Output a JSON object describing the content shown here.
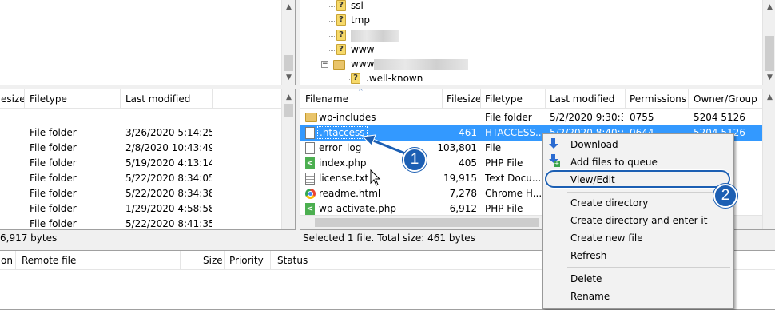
{
  "remote_tree": {
    "items": [
      {
        "label": "ssl"
      },
      {
        "label": "tmp"
      },
      {
        "label": ""
      },
      {
        "label": "www"
      },
      {
        "label": "www"
      },
      {
        "label": ".well-known"
      }
    ]
  },
  "local_list": {
    "headers": {
      "filesize": "esize",
      "filetype": "Filetype",
      "last_modified": "Last modified"
    },
    "rows": [
      {
        "filetype": "File folder",
        "modified": "3/26/2020 5:14:25 ..."
      },
      {
        "filetype": "File folder",
        "modified": "2/8/2020 10:43:49 ..."
      },
      {
        "filetype": "File folder",
        "modified": "5/19/2020 4:13:14 ..."
      },
      {
        "filetype": "File folder",
        "modified": "5/22/2020 8:34:05 ..."
      },
      {
        "filetype": "File folder",
        "modified": "5/22/2020 8:34:38 ..."
      },
      {
        "filetype": "File folder",
        "modified": "1/29/2020 4:58:58 ..."
      },
      {
        "filetype": "File folder",
        "modified": "5/22/2020 8:41:35 ..."
      }
    ],
    "status": "6,917 bytes"
  },
  "remote_list": {
    "headers": {
      "filename": "Filename",
      "filesize": "Filesize",
      "filetype": "Filetype",
      "last_modified": "Last modified",
      "permissions": "Permissions",
      "owner": "Owner/Group"
    },
    "rows": [
      {
        "name": "wp-includes",
        "size": "",
        "type": "File folder",
        "modified": "5/2/2020 9:30:3...",
        "perms": "0755",
        "owner": "5204 5126"
      },
      {
        "name": ".htaccess",
        "size": "461",
        "type": "HTACCESS...",
        "modified": "5/2/2020 8:40:4...",
        "perms": "0644",
        "owner": "5204 5126"
      },
      {
        "name": "error_log",
        "size": "103,801",
        "type": "File",
        "modified": "",
        "perms": "",
        "owner": ""
      },
      {
        "name": "index.php",
        "size": "405",
        "type": "PHP File",
        "modified": "",
        "perms": "",
        "owner": ""
      },
      {
        "name": "license.txt",
        "size": "19,915",
        "type": "Text Docu...",
        "modified": "",
        "perms": "",
        "owner": ""
      },
      {
        "name": "readme.html",
        "size": "7,278",
        "type": "Chrome H...",
        "modified": "",
        "perms": "",
        "owner": ""
      },
      {
        "name": "wp-activate.php",
        "size": "6,912",
        "type": "PHP File",
        "modified": "",
        "perms": "",
        "owner": ""
      }
    ],
    "status": "Selected 1 file. Total size: 461 bytes"
  },
  "queue": {
    "headers": {
      "direction": "on",
      "remote_file": "Remote file",
      "size": "Size",
      "priority": "Priority",
      "status": "Status"
    }
  },
  "context_menu": {
    "items": [
      "Download",
      "Add files to queue",
      "View/Edit",
      "Create directory",
      "Create directory and enter it",
      "Create new file",
      "Refresh",
      "Delete",
      "Rename"
    ]
  },
  "annotations": {
    "badge1": "1",
    "badge2": "2"
  },
  "colors": {
    "selection": "#3399ff",
    "annotation_blue": "#1c5fb3"
  }
}
